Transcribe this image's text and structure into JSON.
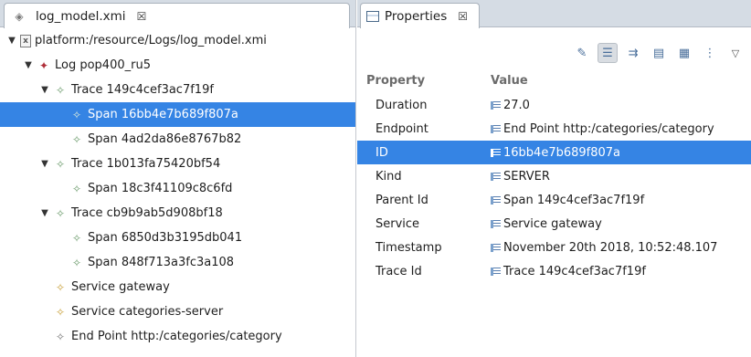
{
  "editor": {
    "tab_title": "log_model.xmi",
    "close_glyph": "☒",
    "tree": [
      {
        "label": "platform:/resource/Logs/log_model.xmi",
        "icon": "file-icon",
        "level": 0,
        "twisty": "▼"
      },
      {
        "label": "Log pop400_ru5",
        "icon": "log-icon",
        "level": 1,
        "twisty": "▼"
      },
      {
        "label": "Trace 149c4cef3ac7f19f",
        "icon": "trace-icon",
        "level": 2,
        "twisty": "▼"
      },
      {
        "label": "Span 16bb4e7b689f807a",
        "icon": "span-icon",
        "level": 3,
        "twisty": "",
        "selected": true
      },
      {
        "label": "Span 4ad2da86e8767b82",
        "icon": "span-icon",
        "level": 3,
        "twisty": ""
      },
      {
        "label": "Trace 1b013fa75420bf54",
        "icon": "trace-icon",
        "level": 2,
        "twisty": "▼"
      },
      {
        "label": "Span 18c3f41109c8c6fd",
        "icon": "span-icon",
        "level": 3,
        "twisty": ""
      },
      {
        "label": "Trace cb9b9ab5d908bf18",
        "icon": "trace-icon",
        "level": 2,
        "twisty": "▼"
      },
      {
        "label": "Span 6850d3b3195db041",
        "icon": "span-icon",
        "level": 3,
        "twisty": ""
      },
      {
        "label": "Span 848f713a3fc3a108",
        "icon": "span-icon",
        "level": 3,
        "twisty": ""
      },
      {
        "label": "Service gateway",
        "icon": "service-icon",
        "level": 2,
        "twisty": ""
      },
      {
        "label": "Service categories-server",
        "icon": "service-icon",
        "level": 2,
        "twisty": ""
      },
      {
        "label": "End Point http:/categories/category",
        "icon": "endpoint-icon",
        "level": 2,
        "twisty": ""
      }
    ]
  },
  "properties": {
    "tab_title": "Properties",
    "close_glyph": "☒",
    "toolbar": [
      "new-item-icon",
      "show-categories-icon",
      "filter-advanced-icon",
      "restore-default-icon",
      "pin-icon",
      "show-advanced-icon",
      "view-menu-icon"
    ],
    "header": {
      "property": "Property",
      "value": "Value"
    },
    "rows": [
      {
        "property": "Duration",
        "value": "27.0"
      },
      {
        "property": "Endpoint",
        "value": "End Point http:/categories/category"
      },
      {
        "property": "ID",
        "value": "16bb4e7b689f807a",
        "selected": true
      },
      {
        "property": "Kind",
        "value": "SERVER"
      },
      {
        "property": "Parent Id",
        "value": "Span 149c4cef3ac7f19f"
      },
      {
        "property": "Service",
        "value": "Service gateway"
      },
      {
        "property": "Timestamp",
        "value": "November 20th 2018, 10:52:48.107"
      },
      {
        "property": "Trace Id",
        "value": "Trace 149c4cef3ac7f19f"
      }
    ]
  },
  "colors": {
    "selection": "#3584e4",
    "tabbar": "#d5dce4"
  }
}
